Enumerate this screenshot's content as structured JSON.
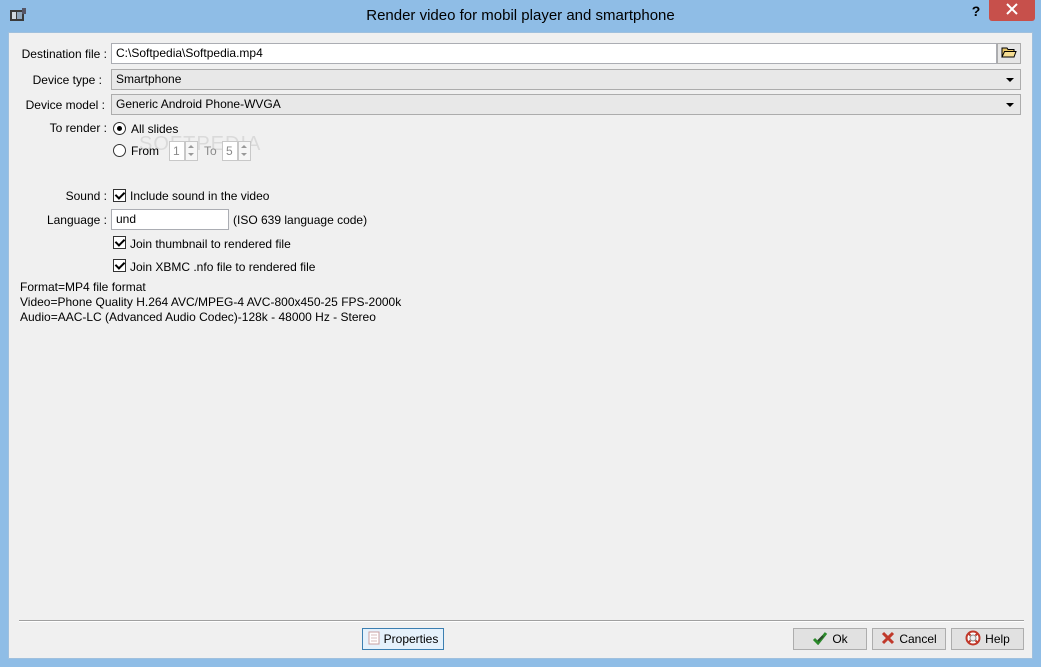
{
  "window": {
    "title": "Render video for mobil player and smartphone",
    "help_glyph": "?",
    "close_glyph": "✕",
    "accent_color": "#8fbde6",
    "close_color": "#c7504b"
  },
  "form": {
    "destination": {
      "label": "Destination file :",
      "value": "C:\\Softpedia\\Softpedia.mp4"
    },
    "device_type": {
      "label": "Device type :",
      "value": "Smartphone"
    },
    "device_model": {
      "label": "Device model :",
      "value": "Generic Android Phone-WVGA"
    },
    "to_render": {
      "label": "To render :",
      "all_slides": "All slides",
      "from_label": "From",
      "from_value": "1",
      "to_label": "To",
      "to_value": "5",
      "selected": "all_slides"
    },
    "sound": {
      "label": "Sound :",
      "checkbox_label": "Include sound in the video",
      "checked": true
    },
    "language": {
      "label": "Language :",
      "value": "und",
      "hint": "(ISO 639 language code)"
    },
    "join_thumbnail": {
      "label": "Join thumbnail to rendered file",
      "checked": true
    },
    "join_xbmc": {
      "label": "Join XBMC .nfo file to rendered file",
      "checked": true
    }
  },
  "info": {
    "format": "Format=MP4 file format",
    "video": "Video=Phone Quality H.264 AVC/MPEG-4 AVC-800x450-25 FPS-2000k",
    "audio": "Audio=AAC-LC (Advanced Audio Codec)-128k - 48000 Hz  - Stereo"
  },
  "watermark": "SOFTPEDIA",
  "buttons": {
    "properties": "Properties",
    "ok": "Ok",
    "cancel": "Cancel",
    "help": "Help"
  }
}
